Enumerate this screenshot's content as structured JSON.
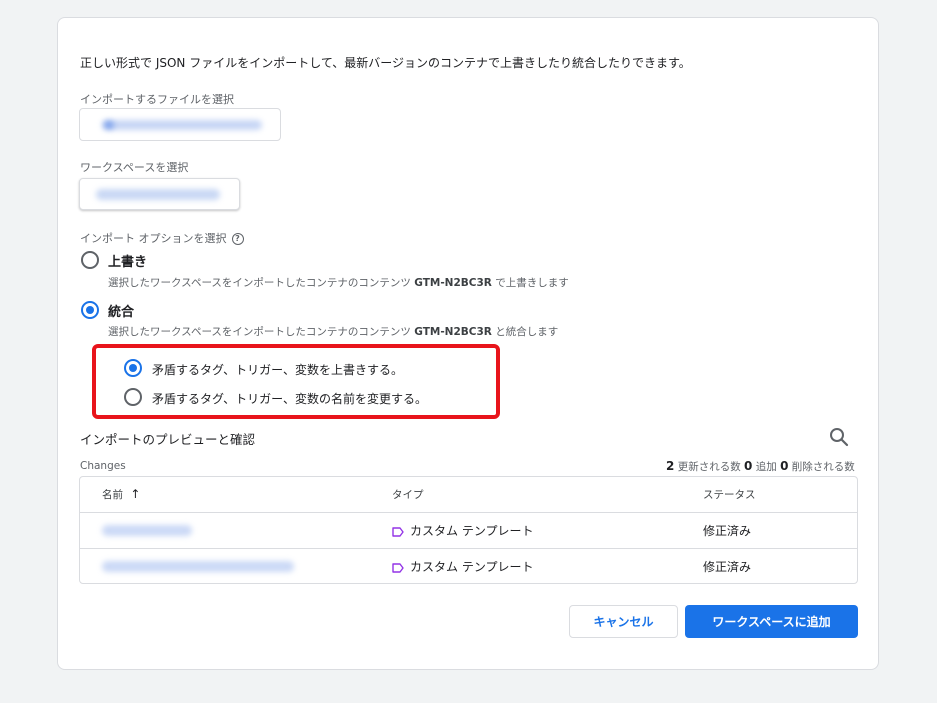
{
  "dialog": {
    "intro": "正しい形式で JSON ファイルをインポートして、最新バージョンのコンテナで上書きしたり統合したりできます。",
    "file_label": "インポートするファイルを選択",
    "workspace_label": "ワークスペースを選択",
    "import_option_label": "インポート オプションを選択",
    "help_glyph": "?",
    "options": [
      {
        "title": "上書き",
        "desc_prefix": "選択したワークスペースをインポートしたコンテナのコンテンツ",
        "container_id": "GTM-N2BC3R",
        "desc_suffix": "で上書きします",
        "checked": false
      },
      {
        "title": "統合",
        "desc_prefix": "選択したワークスペースをインポートしたコンテナのコンテンツ",
        "container_id": "GTM-N2BC3R",
        "desc_suffix": "と統合します",
        "checked": true
      }
    ],
    "merge_options": [
      {
        "label": "矛盾するタグ、トリガー、変数を上書きする。",
        "checked": true
      },
      {
        "label": "矛盾するタグ、トリガー、変数の名前を変更する。",
        "checked": false
      }
    ],
    "highlight_color": "#e8141b",
    "preview_title": "インポートのプレビューと確認",
    "changes_label": "Changes",
    "counts": {
      "updated": "2",
      "updated_text": "更新される数",
      "added": "0",
      "added_text": "追加",
      "deleted": "0",
      "deleted_text": "削除される数"
    },
    "table": {
      "headers": {
        "name": "名前",
        "type": "タイプ",
        "status": "ステータス"
      },
      "sort_glyph": "↑",
      "rows": [
        {
          "type": "カスタム テンプレート",
          "status": "修正済み"
        },
        {
          "type": "カスタム テンプレート",
          "status": "修正済み"
        }
      ]
    },
    "buttons": {
      "cancel": "キャンセル",
      "add": "ワークスペースに追加"
    },
    "colors": {
      "accent": "#1a73e8",
      "tag_icon": "#9334e6"
    },
    "icons": [
      "help-icon",
      "search-icon",
      "sort-arrow-icon",
      "template-tag-icon"
    ]
  }
}
